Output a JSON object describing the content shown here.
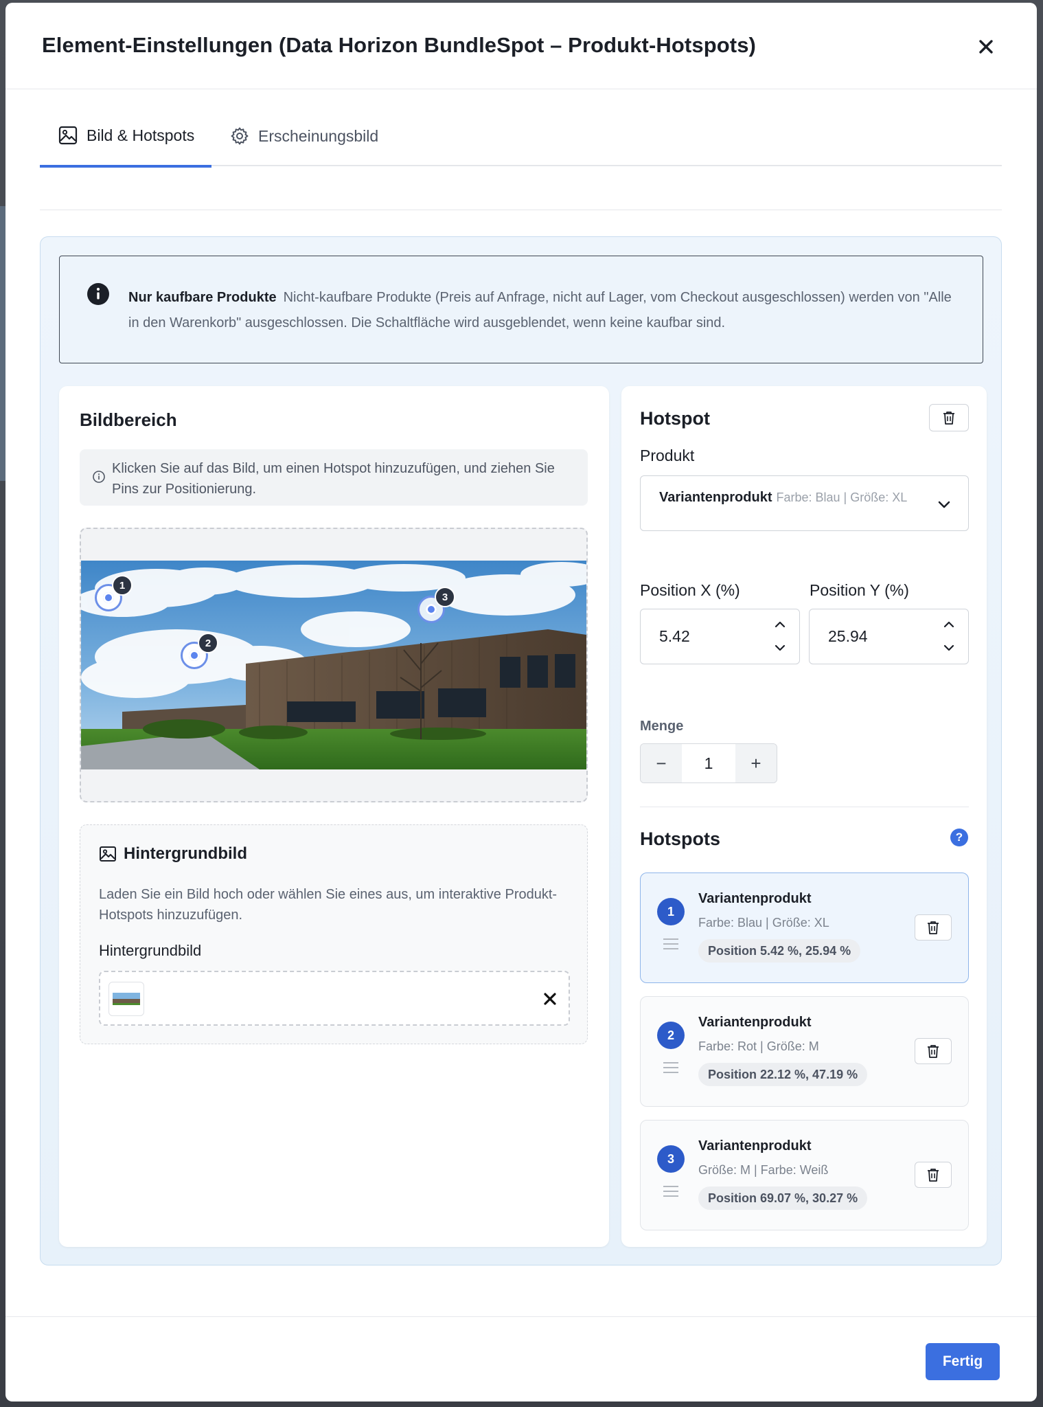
{
  "modal": {
    "title": "Element-Einstellungen (Data Horizon BundleSpot – Produkt-Hotspots)"
  },
  "tabs": [
    {
      "label": "Bild & Hotspots",
      "icon": "image-icon",
      "active": true
    },
    {
      "label": "Erscheinungsbild",
      "icon": "gear-icon",
      "active": false
    }
  ],
  "info": {
    "title": "Nur kaufbare Produkte",
    "text": "Nicht-kaufbare Produkte (Preis auf Anfrage, nicht auf Lager, vom Checkout ausgeschlossen) werden von \"Alle in den Warenkorb\" ausgeschlossen. Die Schaltfläche wird ausgeblendet, wenn keine kaufbar sind."
  },
  "image_section": {
    "title": "Bildbereich",
    "hint": "Klicken Sie auf das Bild, um einen Hotspot hinzuzufügen, und ziehen Sie Pins zur Positionierung.",
    "pins": [
      {
        "number": "1"
      },
      {
        "number": "2"
      },
      {
        "number": "3"
      }
    ]
  },
  "background": {
    "title": "Hintergrundbild",
    "description": "Laden Sie ein Bild hoch oder wählen Sie eines aus, um interaktive Produkt-Hotspots hinzuzufügen.",
    "field_label": "Hintergrundbild"
  },
  "hotspot": {
    "title": "Hotspot",
    "product_label": "Produkt",
    "product_name": "Variantenprodukt",
    "product_variant": "Farbe: Blau | Größe: XL",
    "pos_x_label": "Position X (%)",
    "pos_y_label": "Position Y (%)",
    "pos_x": "5.42",
    "pos_y": "25.94",
    "qty_label": "Menge",
    "qty": "1",
    "minus": "−",
    "plus": "+"
  },
  "hotspots_list": {
    "title": "Hotspots",
    "help": "?",
    "items": [
      {
        "number": "1",
        "name": "Variantenprodukt",
        "attrs": "Farbe: Blau | Größe: XL",
        "position": "Position 5.42 %, 25.94 %",
        "active": true
      },
      {
        "number": "2",
        "name": "Variantenprodukt",
        "attrs": "Farbe: Rot | Größe: M",
        "position": "Position 22.12 %, 47.19 %",
        "active": false
      },
      {
        "number": "3",
        "name": "Variantenprodukt",
        "attrs": "Größe: M | Farbe: Weiß",
        "position": "Position 69.07 %, 30.27 %",
        "active": false
      }
    ]
  },
  "footer": {
    "done_label": "Fertig"
  },
  "colors": {
    "accent": "#3b6fe0",
    "badge": "#2d5bc9",
    "panel_bg": "#eef5fc"
  }
}
